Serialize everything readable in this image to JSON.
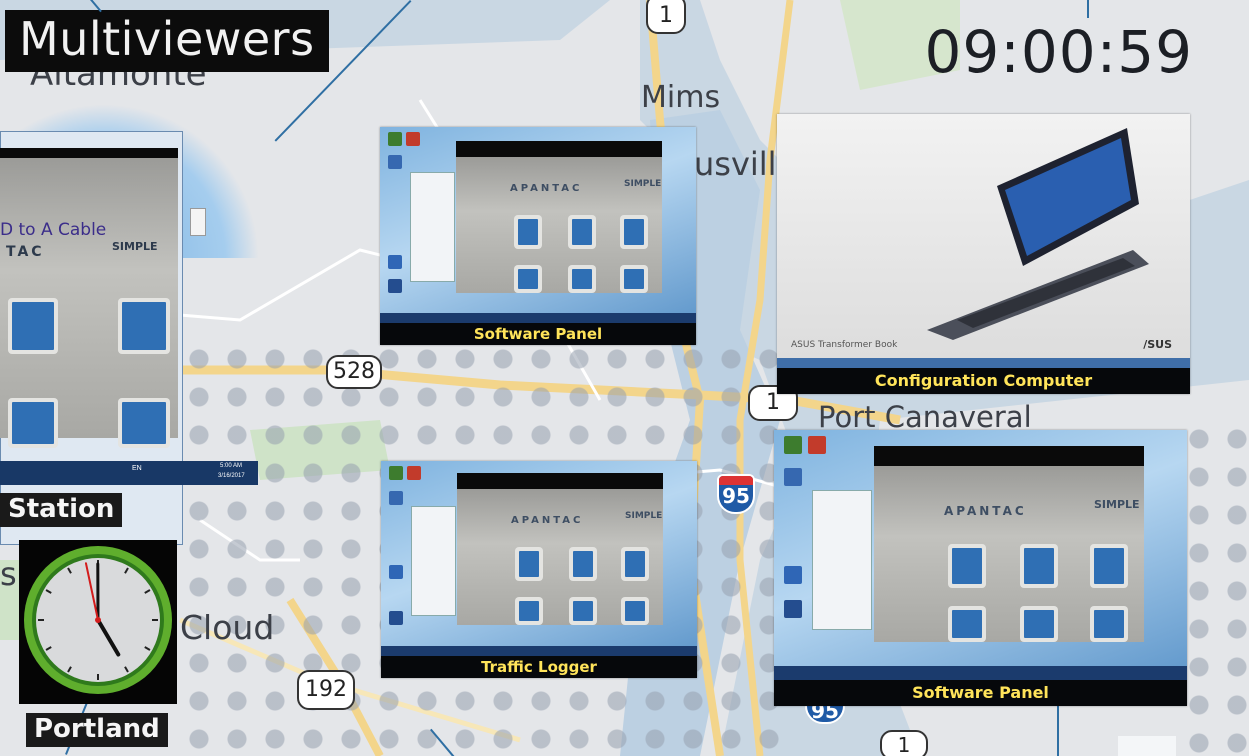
{
  "header": {
    "title": "Multiviewers",
    "time": "09:00:59"
  },
  "map_labels": {
    "altamonte": "Altamonte",
    "mims": "Mims",
    "titusville": "usvill",
    "port_canaveral": "Port Canaveral",
    "cloud": "Cloud",
    "s_fragment": "s"
  },
  "route_shields": {
    "us1_top": "1",
    "sr528": "528",
    "us1_mid": "1",
    "sr192": "192",
    "us1_bottom": "1",
    "i95_mid": "95",
    "i95_bottom": "95"
  },
  "tiles": {
    "left": {
      "overlay_text": "D to A Cable",
      "logo": "TAC",
      "logo2": "SIMPLE",
      "tray_text": "EN",
      "tray_time": "5:00 AM",
      "tray_date": "3/16/2017"
    },
    "software_panel_top": {
      "caption": "Software Panel",
      "logo": "APANTAC",
      "logo2": "SIMPLE"
    },
    "configuration": {
      "caption": "Configuration Computer",
      "product": "ASUS Transformer Book",
      "brand": "/SUS"
    },
    "traffic_logger": {
      "caption": "Traffic Logger",
      "logo": "APANTAC",
      "logo2": "SIMPLE"
    },
    "software_panel_bottom": {
      "caption": "Software Panel",
      "logo": "APANTAC",
      "logo2": "SIMPLE"
    }
  },
  "station": {
    "label": "Station",
    "city": "Portland",
    "analog_time": {
      "hour": 4,
      "minute": 59,
      "second": 58
    }
  },
  "colors": {
    "caption_text": "#ffe45a",
    "caption_bg": "#06080b",
    "leader_lines": "#2f6fa3",
    "map_water": "#c9d7e3",
    "map_land": "#e3e6ea",
    "clock_ring": "#5fae2d"
  }
}
